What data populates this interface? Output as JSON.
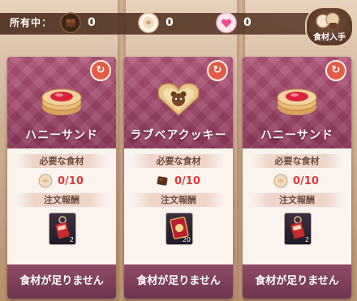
{
  "inventory": {
    "label": "所有中：",
    "items": [
      {
        "icon": "chocolate-icon",
        "count": "0"
      },
      {
        "icon": "rose-icon",
        "count": "0"
      },
      {
        "icon": "heart-gem-icon",
        "count": "0"
      }
    ],
    "get_button": "食材入手"
  },
  "cards": [
    {
      "name": "ハニーサンド",
      "dish_icon": "honey-sandwich-cookie-icon",
      "required_label": "必要な食材",
      "required_icon": "rose-icon",
      "required_count": "0/10",
      "reward_label": "注文報酬",
      "reward_icon": "keychain-icon",
      "reward_count": "2",
      "status": "食材が足りません"
    },
    {
      "name": "ラブベアクッキー",
      "dish_icon": "love-bear-cookie-icon",
      "required_label": "必要な食材",
      "required_icon": "chocolate-icon",
      "required_count": "0/10",
      "reward_label": "注文報酬",
      "reward_icon": "card-icon",
      "reward_count": "20",
      "status": "食材が足りません"
    },
    {
      "name": "ハニーサンド",
      "dish_icon": "honey-sandwich-cookie-icon",
      "required_label": "必要な食材",
      "required_icon": "rose-icon",
      "required_count": "0/10",
      "reward_label": "注文報酬",
      "reward_icon": "keychain-icon",
      "reward_count": "2",
      "status": "食材が足りません"
    }
  ]
}
